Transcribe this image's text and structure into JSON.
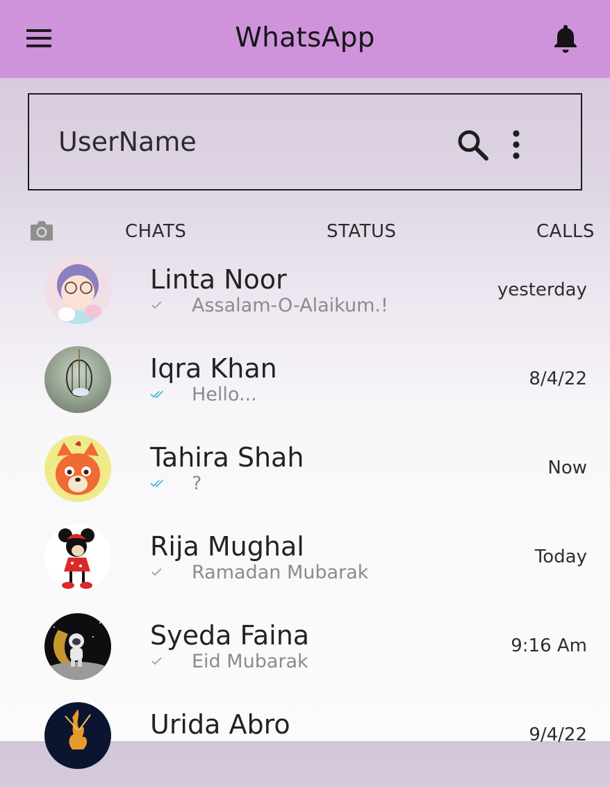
{
  "appbar": {
    "title": "WhatsApp"
  },
  "search": {
    "username": "UserName"
  },
  "tabs": {
    "chats": "CHATS",
    "status": "STATUS",
    "calls": "CALLS"
  },
  "colors": {
    "appbar": "#cf93dc",
    "read_tick": "#4fb3e8",
    "sent_tick": "#9e9e9e"
  },
  "chats": [
    {
      "name": "Linta Noor",
      "message": "Assalam-O-Alaikum.!",
      "time": "yesterday",
      "tick": "single"
    },
    {
      "name": "Iqra Khan",
      "message": "Hello...",
      "time": "8/4/22",
      "tick": "double-blue"
    },
    {
      "name": "Tahira Shah",
      "message": "?",
      "time": "Now",
      "tick": "double-blue"
    },
    {
      "name": "Rija Mughal",
      "message": "Ramadan Mubarak",
      "time": "Today",
      "tick": "single"
    },
    {
      "name": "Syeda Faina",
      "message": "Eid Mubarak",
      "time": "9:16 Am",
      "tick": "single"
    },
    {
      "name": "Urida Abro",
      "message": "",
      "time": "9/4/22",
      "tick": "none"
    }
  ]
}
